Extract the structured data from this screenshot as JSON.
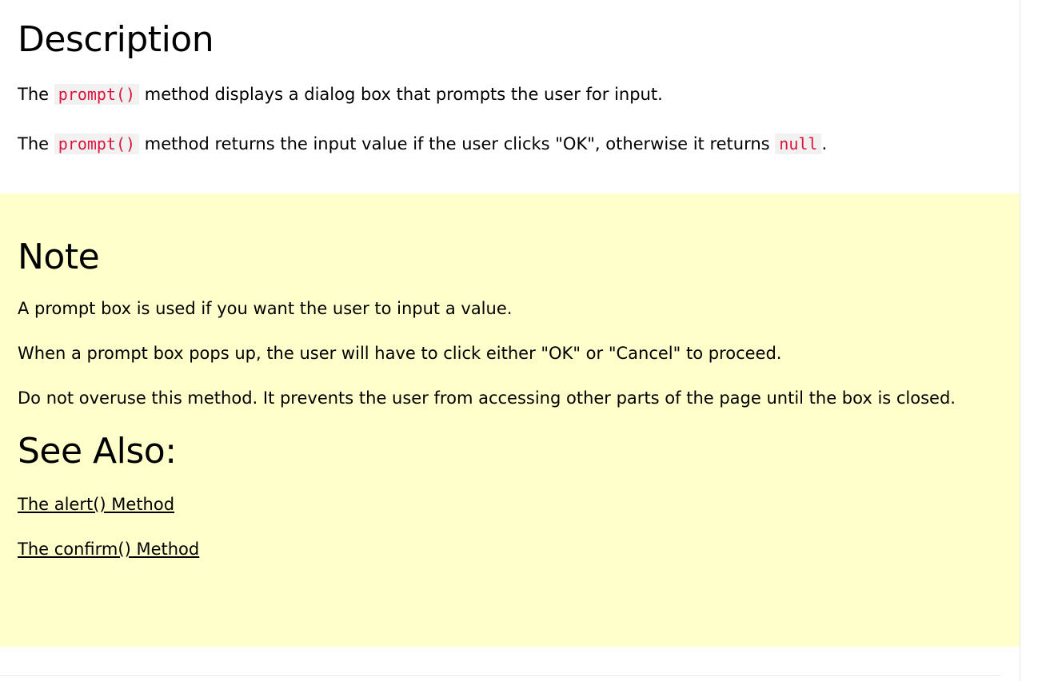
{
  "description": {
    "title": "Description",
    "p1": {
      "before": "The ",
      "code": "prompt()",
      "after": " method displays a dialog box that prompts the user for input."
    },
    "p2": {
      "before": "The ",
      "code": "prompt()",
      "middle": " method returns the input value if the user clicks \"OK\", otherwise it returns ",
      "code2": "null",
      "after": "."
    }
  },
  "note": {
    "title": "Note",
    "paragraphs": [
      "A prompt box is used if you want the user to input a value.",
      "When a prompt box pops up, the user will have to click either \"OK\" or \"Cancel\" to proceed.",
      "Do not overuse this method. It prevents the user from accessing other parts of the page until the box is closed."
    ],
    "background": "#ffffcc"
  },
  "see_also": {
    "title": "See Also:",
    "links": [
      "The alert() Method",
      "The confirm() Method"
    ]
  },
  "colors": {
    "code_text": "#dc143c",
    "code_bg": "#f1f1f1"
  }
}
